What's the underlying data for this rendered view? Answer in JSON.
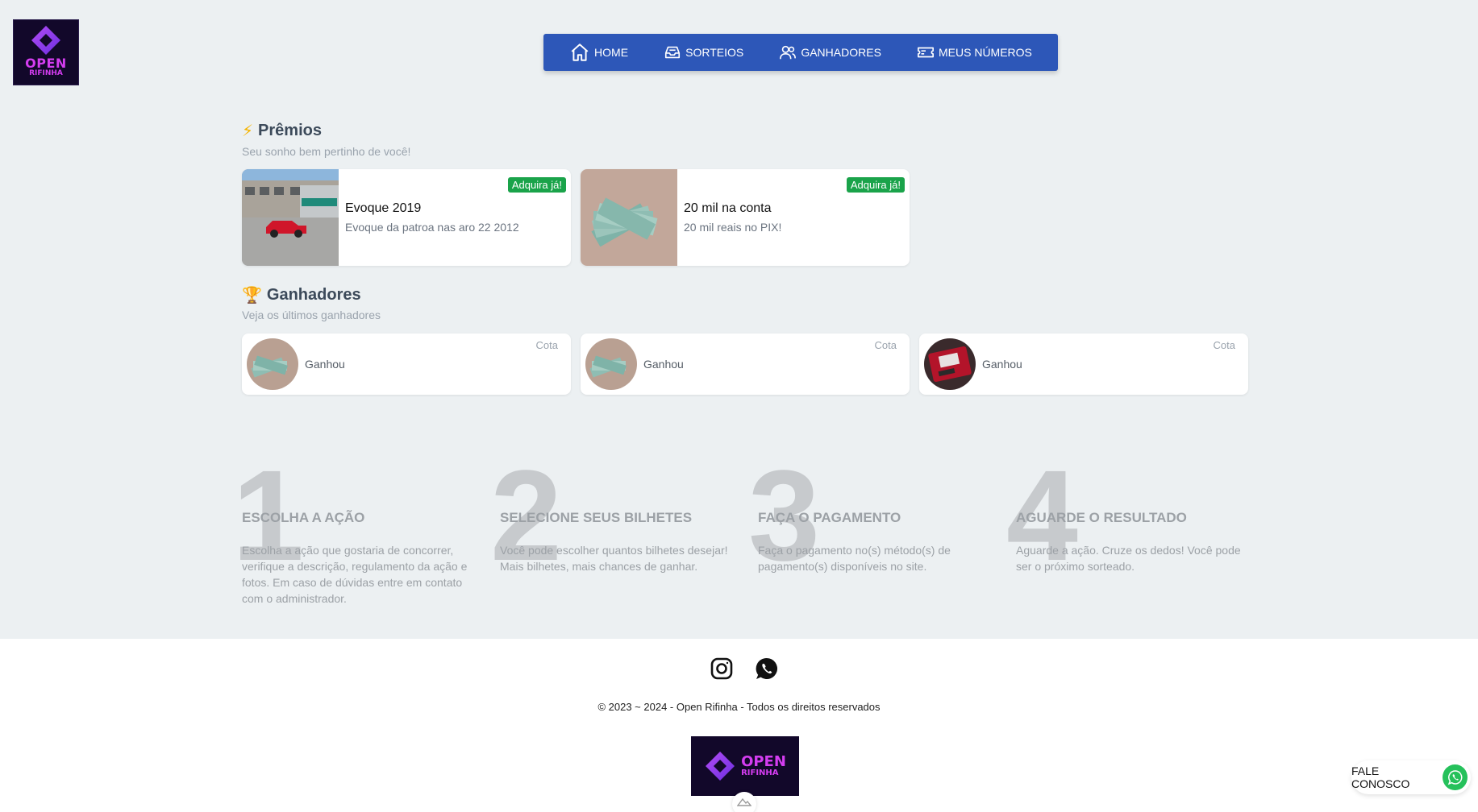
{
  "brand": {
    "logo_line1": "OPEN",
    "logo_line2": "RIFINHA",
    "accent": "#d43df0",
    "nav_color": "#2d57b8"
  },
  "nav": [
    {
      "label": "HOME",
      "icon": "home-icon"
    },
    {
      "label": "SORTEIOS",
      "icon": "inbox-icon"
    },
    {
      "label": "GANHADORES",
      "icon": "users-icon"
    },
    {
      "label": "MEUS NÚMEROS",
      "icon": "ticket-icon"
    }
  ],
  "premios": {
    "emoji": "⚡",
    "title": "Prêmios",
    "subtitle": "Seu sonho bem pertinho de você!",
    "items": [
      {
        "badge": "Adquira já!",
        "title": "Evoque 2019",
        "desc": "Evoque da patroa nas aro 22 2012",
        "image": "car-photo"
      },
      {
        "badge": "Adquira já!",
        "title": "20 mil na conta",
        "desc": "20 mil reais no PIX!",
        "image": "money-photo"
      }
    ]
  },
  "ganhadores": {
    "emoji": "🏆",
    "title": "Ganhadores",
    "subtitle": "Veja os últimos ganhadores",
    "items": [
      {
        "won": "Ganhou",
        "cota": "Cota",
        "image": "money-photo"
      },
      {
        "won": "Ganhou",
        "cota": "Cota",
        "image": "money-photo"
      },
      {
        "won": "Ganhou",
        "cota": "Cota",
        "image": "card-photo"
      }
    ]
  },
  "steps": [
    {
      "num": "1",
      "title": "ESCOLHA A AÇÃO",
      "text": "Escolha a ação que gostaria de concorrer, verifique a descrição, regulamento da ação e fotos. Em caso de dúvidas entre em contato com o administrador."
    },
    {
      "num": "2",
      "title": "SELECIONE SEUS BILHETES",
      "text": "Você pode escolher quantos bilhetes desejar! Mais bilhetes, mais chances de ganhar."
    },
    {
      "num": "3",
      "title": "FAÇA O PAGAMENTO",
      "text": "Faça o pagamento no(s) método(s) de pagamento(s) disponíveis no site."
    },
    {
      "num": "4",
      "title": "AGUARDE O RESULTADO",
      "text": "Aguarde a ação. Cruze os dedos! Você pode ser o próximo sorteado."
    }
  ],
  "footer": {
    "copyright": "© 2023 ~ 2024 - Open Rifinha - Todos os direitos reservados",
    "social": [
      "instagram-icon",
      "whatsapp-icon"
    ],
    "logo_line1": "OPEN",
    "logo_line2": "RIFINHA"
  },
  "contact": {
    "label": "FALE CONOSCO"
  }
}
